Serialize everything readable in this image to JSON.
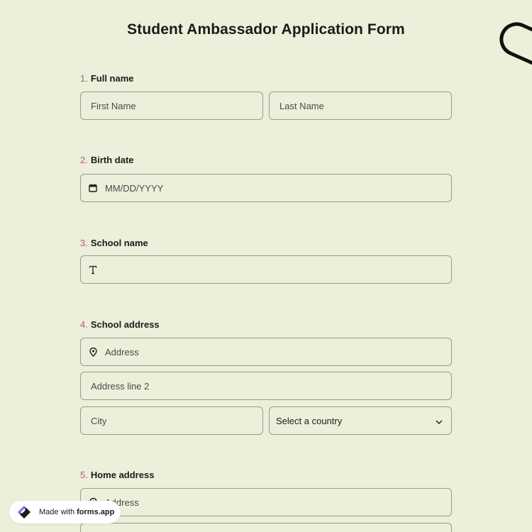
{
  "form": {
    "title": "Student Ambassador Application Form"
  },
  "questions": [
    {
      "num": "1.",
      "label": "Full name",
      "fields": [
        {
          "placeholder": "First Name"
        },
        {
          "placeholder": "Last Name"
        }
      ]
    },
    {
      "num": "2.",
      "label": "Birth date",
      "fields": [
        {
          "placeholder": "MM/DD/YYYY",
          "icon": "calendar-icon"
        }
      ]
    },
    {
      "num": "3.",
      "label": "School name",
      "fields": [
        {
          "placeholder": "",
          "icon": "text-type-icon"
        }
      ]
    },
    {
      "num": "4.",
      "label": "School address",
      "fields": [
        {
          "placeholder": "Address",
          "icon": "location-pin-icon"
        },
        {
          "placeholder": "Address line 2"
        },
        {
          "placeholder": "City"
        },
        {
          "placeholder": "Select a country",
          "icon": "chevron-down-icon"
        }
      ]
    },
    {
      "num": "5.",
      "label": "Home address",
      "fields": [
        {
          "placeholder": "Address",
          "icon": "location-pin-icon"
        }
      ]
    }
  ],
  "badge": {
    "prefix": "Made with",
    "brand": "forms.app"
  },
  "colors": {
    "background": "#ecefd9",
    "question_number": "#b35b75",
    "field_border": "#9a9a90"
  }
}
